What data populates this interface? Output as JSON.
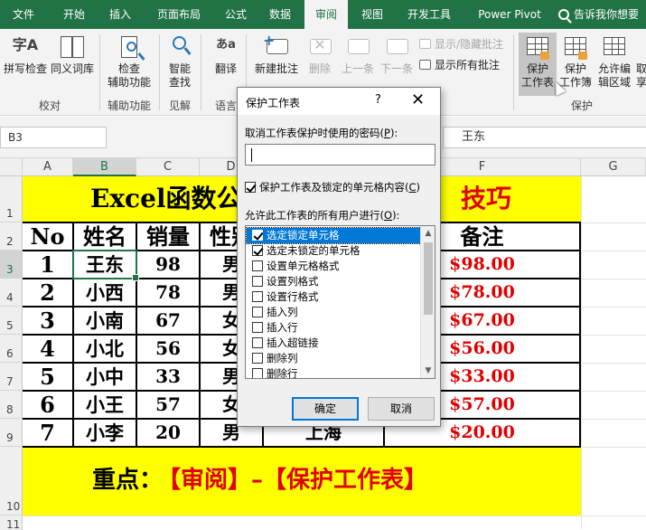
{
  "ribbon_tabs": [
    "文件",
    "开始",
    "插入",
    "页面布局",
    "公式",
    "数据",
    "审阅",
    "视图",
    "开发工具",
    "Power Pivot"
  ],
  "active_tab": "审阅",
  "tell_me": "告诉我你想要",
  "ribbon": {
    "spell_check": "拼写检查",
    "thesaurus": "同义词库",
    "group_proofing": "校对",
    "check_access_1": "检查",
    "check_access_2": "辅助功能",
    "group_access": "辅助功能",
    "smart_lookup_1": "智能",
    "smart_lookup_2": "查找",
    "group_insights": "见解",
    "translate": "翻译",
    "group_language": "语言",
    "new_comment": "新建批注",
    "delete": "删除",
    "previous": "上一条",
    "next": "下一条",
    "show_hide_comment": "显示/隐藏批注",
    "show_all_comments": "显示所有批注",
    "protect_sheet_1": "保护",
    "protect_sheet_2": "工作表",
    "protect_workbook_1": "保护",
    "protect_workbook_2": "工作簿",
    "allow_edit_1": "允许编",
    "allow_edit_2": "辑区域",
    "more_1": "取",
    "more_2": "享",
    "group_protect": "保护"
  },
  "name_box": "B3",
  "formula_value": "王东",
  "columns": [
    "A",
    "B",
    "C",
    "D",
    "E",
    "F",
    "G"
  ],
  "rows": [
    "1",
    "2",
    "3",
    "4",
    "5",
    "6",
    "7",
    "8",
    "9",
    "10",
    "11"
  ],
  "sheet": {
    "title_left": "Excel函数公",
    "title_right": "技巧",
    "headers": {
      "a": "No",
      "b": "姓名",
      "c": "销量",
      "d": "性别",
      "f": "备注"
    },
    "data": [
      {
        "no": "1",
        "name": "王东",
        "sales": "98",
        "gender": "男",
        "note": "$98.00"
      },
      {
        "no": "2",
        "name": "小西",
        "sales": "78",
        "gender": "男",
        "note": "$78.00"
      },
      {
        "no": "3",
        "name": "小南",
        "sales": "67",
        "gender": "女",
        "note": "$67.00"
      },
      {
        "no": "4",
        "name": "小北",
        "sales": "56",
        "gender": "女",
        "note": "$56.00"
      },
      {
        "no": "5",
        "name": "小中",
        "sales": "33",
        "gender": "男",
        "note": "$33.00"
      },
      {
        "no": "6",
        "name": "小王",
        "sales": "57",
        "gender": "女",
        "note": "$57.00"
      },
      {
        "no": "7",
        "name": "小李",
        "sales": "20",
        "gender": "男",
        "note": "$20.00"
      }
    ],
    "row9_city": "上海",
    "key_label": "重点：",
    "key_text": "【审阅】–【保护工作表】"
  },
  "dialog": {
    "title": "保护工作表",
    "help": "?",
    "close": "✕",
    "password_label": "取消工作表保护时使用的密码(",
    "password_key": "P",
    "password_tail": "):",
    "password_value": "",
    "protect_checkbox": "保护工作表及锁定的单元格内容(",
    "protect_key": "C",
    "protect_tail": ")",
    "allow_label": "允许此工作表的所有用户进行(",
    "allow_key": "O",
    "allow_tail": "):",
    "options": [
      {
        "label": "选定锁定单元格",
        "checked": true
      },
      {
        "label": "选定未锁定的单元格",
        "checked": true
      },
      {
        "label": "设置单元格格式",
        "checked": false
      },
      {
        "label": "设置列格式",
        "checked": false
      },
      {
        "label": "设置行格式",
        "checked": false
      },
      {
        "label": "插入列",
        "checked": false
      },
      {
        "label": "插入行",
        "checked": false
      },
      {
        "label": "插入超链接",
        "checked": false
      },
      {
        "label": "删除列",
        "checked": false
      },
      {
        "label": "删除行",
        "checked": false
      }
    ],
    "ok": "确定",
    "cancel": "取消"
  }
}
